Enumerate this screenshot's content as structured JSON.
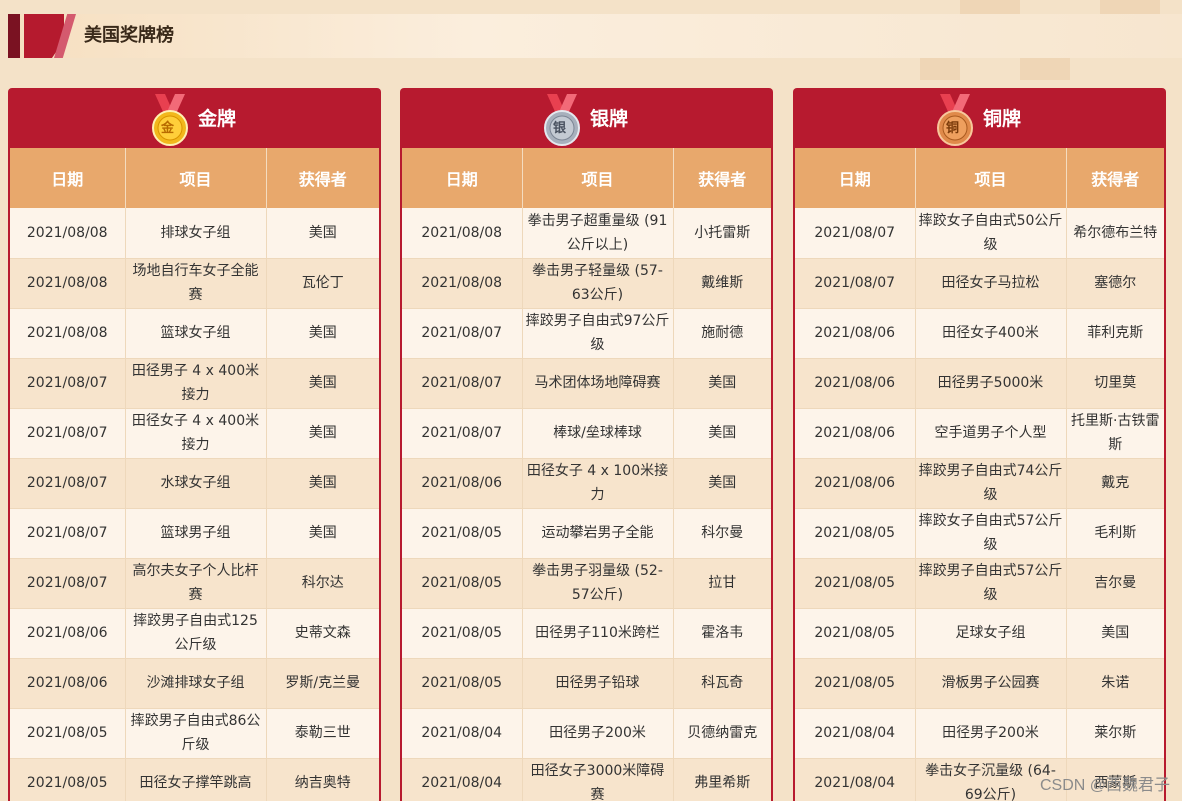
{
  "page": {
    "title": "美国奖牌榜",
    "watermark": "CSDN @西魏君子"
  },
  "columns": [
    "日期",
    "项目",
    "获得者"
  ],
  "panels": {
    "gold": {
      "label": "金牌",
      "medal_char": "金",
      "medal_color": "#f2b81c",
      "rows": [
        [
          "2021/08/08",
          "排球女子组",
          "美国"
        ],
        [
          "2021/08/08",
          "场地自行车女子全能赛",
          "瓦伦丁"
        ],
        [
          "2021/08/08",
          "篮球女子组",
          "美国"
        ],
        [
          "2021/08/07",
          "田径男子 4 x 400米接力",
          "美国"
        ],
        [
          "2021/08/07",
          "田径女子 4 x 400米接力",
          "美国"
        ],
        [
          "2021/08/07",
          "水球女子组",
          "美国"
        ],
        [
          "2021/08/07",
          "篮球男子组",
          "美国"
        ],
        [
          "2021/08/07",
          "高尔夫女子个人比杆赛",
          "科尔达"
        ],
        [
          "2021/08/06",
          "摔跤男子自由式125公斤级",
          "史蒂文森"
        ],
        [
          "2021/08/06",
          "沙滩排球女子组",
          "罗斯/克兰曼"
        ],
        [
          "2021/08/05",
          "摔跤男子自由式86公斤级",
          "泰勒三世"
        ],
        [
          "2021/08/05",
          "田径女子撑竿跳高",
          "纳吉奥特"
        ]
      ]
    },
    "silver": {
      "label": "银牌",
      "medal_char": "银",
      "medal_color": "#a8b0bc",
      "rows": [
        [
          "2021/08/08",
          "拳击男子超重量级 (91公斤以上)",
          "小托雷斯"
        ],
        [
          "2021/08/08",
          "拳击男子轻量级 (57-63公斤)",
          "戴维斯"
        ],
        [
          "2021/08/07",
          "摔跤男子自由式97公斤级",
          "施耐德"
        ],
        [
          "2021/08/07",
          "马术团体场地障碍赛",
          "美国"
        ],
        [
          "2021/08/07",
          "棒球/垒球棒球",
          "美国"
        ],
        [
          "2021/08/06",
          "田径女子 4 x 100米接力",
          "美国"
        ],
        [
          "2021/08/05",
          "运动攀岩男子全能",
          "科尔曼"
        ],
        [
          "2021/08/05",
          "拳击男子羽量级 (52-57公斤)",
          "拉甘"
        ],
        [
          "2021/08/05",
          "田径男子110米跨栏",
          "霍洛韦"
        ],
        [
          "2021/08/05",
          "田径男子铅球",
          "科瓦奇"
        ],
        [
          "2021/08/04",
          "田径男子200米",
          "贝德纳雷克"
        ],
        [
          "2021/08/04",
          "田径女子3000米障碍赛",
          "弗里希斯"
        ]
      ]
    },
    "bronze": {
      "label": "铜牌",
      "medal_char": "铜",
      "medal_color": "#e08a4a",
      "rows": [
        [
          "2021/08/07",
          "摔跤女子自由式50公斤级",
          "希尔德布兰特"
        ],
        [
          "2021/08/07",
          "田径女子马拉松",
          "塞德尔"
        ],
        [
          "2021/08/06",
          "田径女子400米",
          "菲利克斯"
        ],
        [
          "2021/08/06",
          "田径男子5000米",
          "切里莫"
        ],
        [
          "2021/08/06",
          "空手道男子个人型",
          "托里斯·古铁雷斯"
        ],
        [
          "2021/08/06",
          "摔跤男子自由式74公斤级",
          "戴克"
        ],
        [
          "2021/08/05",
          "摔跤女子自由式57公斤级",
          "毛利斯"
        ],
        [
          "2021/08/05",
          "摔跤男子自由式57公斤级",
          "吉尔曼"
        ],
        [
          "2021/08/05",
          "足球女子组",
          "美国"
        ],
        [
          "2021/08/05",
          "滑板男子公园赛",
          "朱诺"
        ],
        [
          "2021/08/04",
          "田径男子200米",
          "莱尔斯"
        ],
        [
          "2021/08/04",
          "拳击女子沉量级 (64-69公斤)",
          "西蒙斯"
        ]
      ]
    }
  }
}
